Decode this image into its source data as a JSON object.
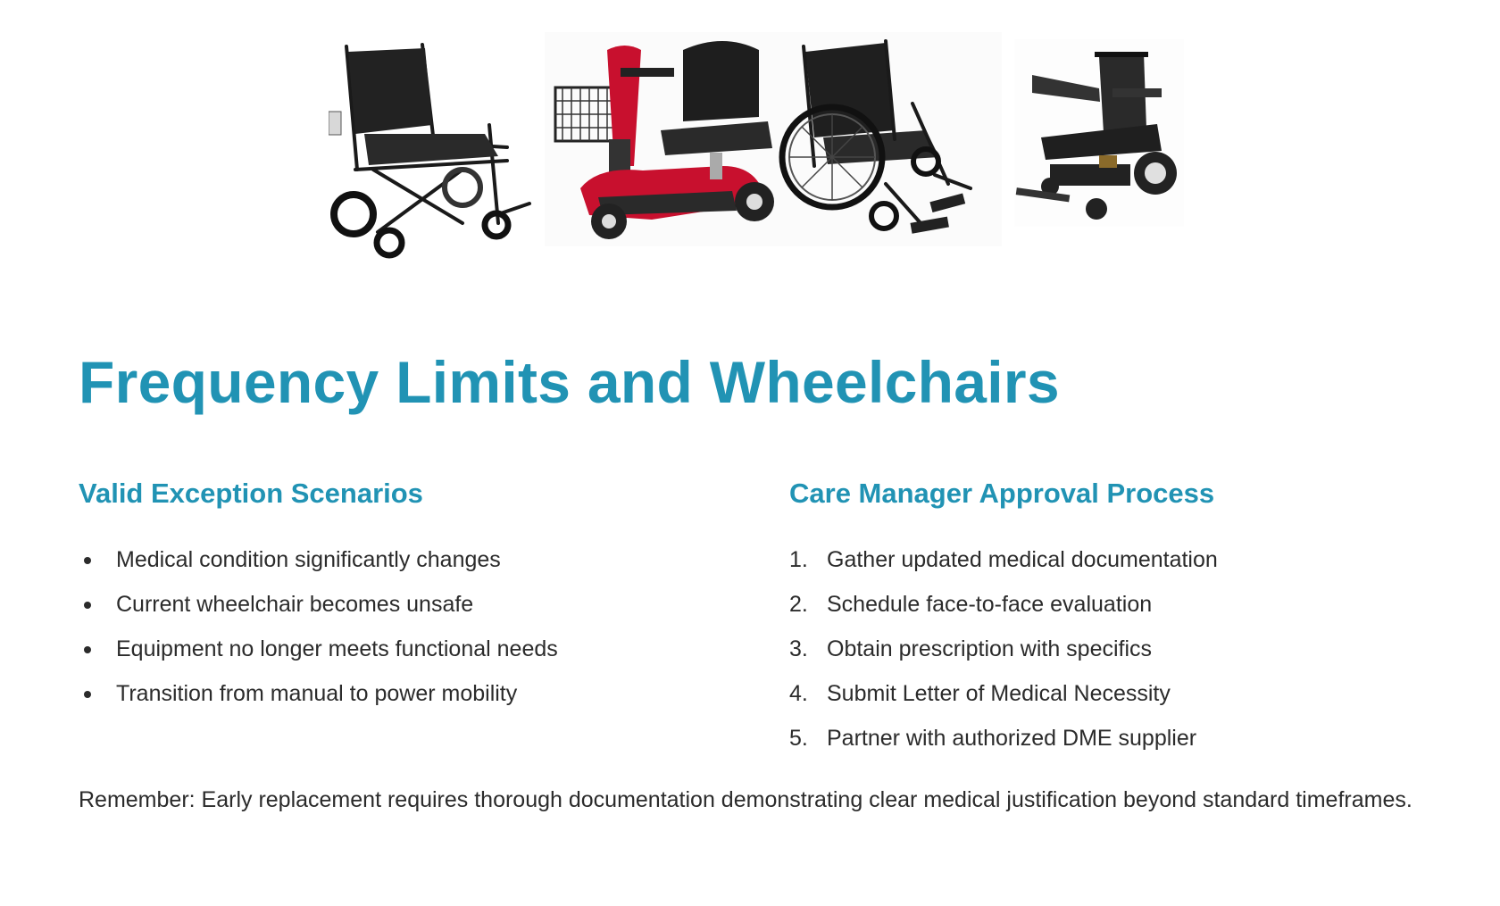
{
  "images": [
    {
      "icon": "transport-wheelchair-icon",
      "alt": "transport wheelchair"
    },
    {
      "icon": "mobility-scooter-icon",
      "alt": "red mobility scooter"
    },
    {
      "icon": "manual-wheelchair-icon",
      "alt": "standard manual wheelchair"
    },
    {
      "icon": "power-wheelchair-icon",
      "alt": "folding power wheelchair"
    }
  ],
  "colors": {
    "accent": "#2193b4",
    "text": "#2b2b2b",
    "scooter_red": "#c8102e"
  },
  "title": "Frequency Limits and Wheelchairs",
  "left": {
    "heading": "Valid Exception Scenarios",
    "items": [
      "Medical condition significantly changes",
      "Current wheelchair becomes unsafe",
      "Equipment no longer meets functional needs",
      "Transition from manual to power mobility"
    ]
  },
  "right": {
    "heading": "Care Manager Approval Process",
    "items": [
      {
        "num": "1.",
        "text": "Gather updated medical documentation"
      },
      {
        "num": "2.",
        "text": "Schedule face-to-face evaluation"
      },
      {
        "num": "3.",
        "text": "Obtain prescription with specifics"
      },
      {
        "num": "4.",
        "text": "Submit Letter of Medical Necessity"
      },
      {
        "num": "5.",
        "text": "Partner with authorized DME supplier"
      }
    ]
  },
  "remember": "Remember: Early replacement requires thorough documentation demonstrating clear medical justification beyond standard timeframes."
}
